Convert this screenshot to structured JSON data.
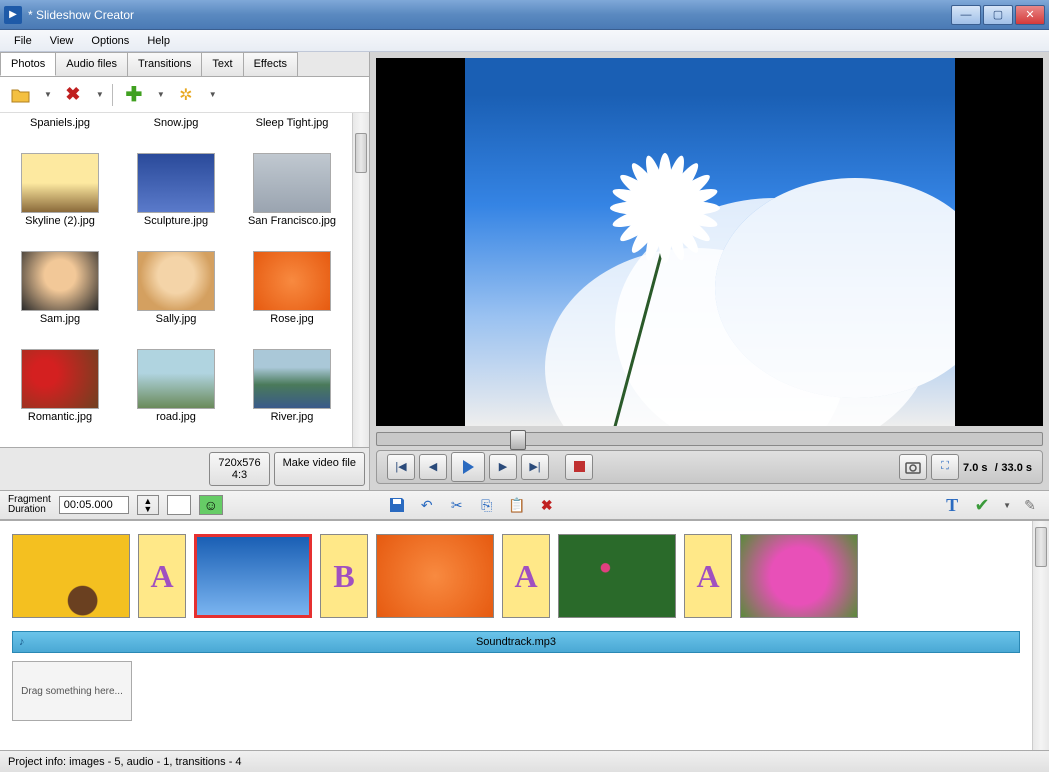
{
  "window": {
    "title": "* Slideshow Creator"
  },
  "menu": {
    "file": "File",
    "view": "View",
    "options": "Options",
    "help": "Help"
  },
  "tabs": {
    "photos": "Photos",
    "audio": "Audio files",
    "transitions": "Transitions",
    "text": "Text",
    "effects": "Effects"
  },
  "photos": {
    "row0": [
      "Spaniels.jpg",
      "Snow.jpg",
      "Sleep Tight.jpg"
    ],
    "items": [
      {
        "label": "Skyline (2).jpg",
        "cls": "bg-sky"
      },
      {
        "label": "Sculpture.jpg",
        "cls": "bg-statue"
      },
      {
        "label": "San Francisco.jpg",
        "cls": "bg-city"
      },
      {
        "label": "Sam.jpg",
        "cls": "bg-face1"
      },
      {
        "label": "Sally.jpg",
        "cls": "bg-face2"
      },
      {
        "label": "Rose.jpg",
        "cls": "bg-rose"
      },
      {
        "label": "Romantic.jpg",
        "cls": "bg-roses"
      },
      {
        "label": "road.jpg",
        "cls": "bg-road"
      },
      {
        "label": "River.jpg",
        "cls": "bg-river"
      }
    ]
  },
  "size": {
    "resolution": "720x576",
    "aspect": "4:3",
    "make": "Make video file"
  },
  "timecode": {
    "current": "7.0 s",
    "sep": "/",
    "total": "33.0 s"
  },
  "fragment": {
    "label": "Fragment\nDuration",
    "value": "00:05.000"
  },
  "audio": {
    "track": "Soundtrack.mp3"
  },
  "timeline": {
    "items": [
      {
        "type": "img",
        "cls": "bg-sunflower"
      },
      {
        "type": "trans",
        "letter": "A"
      },
      {
        "type": "img",
        "cls": "bg-daisy",
        "selected": true
      },
      {
        "type": "trans",
        "letter": "B"
      },
      {
        "type": "img",
        "cls": "bg-rose"
      },
      {
        "type": "trans",
        "letter": "A"
      },
      {
        "type": "img",
        "cls": "bg-green"
      },
      {
        "type": "trans",
        "letter": "A"
      },
      {
        "type": "img",
        "cls": "bg-pink"
      }
    ],
    "dragtext": "Drag something here..."
  },
  "status": {
    "text": "Project info: images - 5, audio - 1, transitions - 4"
  }
}
